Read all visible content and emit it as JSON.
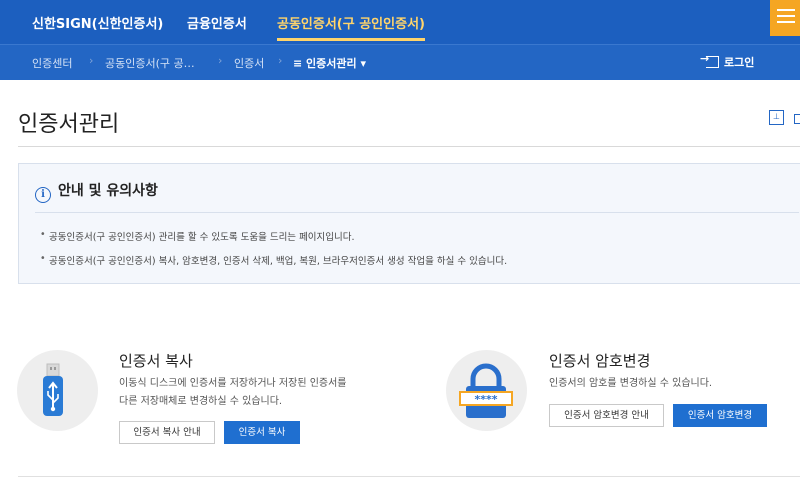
{
  "topnav": {
    "tabs": [
      {
        "label": "신한SIGN(신한인증서)"
      },
      {
        "label": "금융인증서"
      },
      {
        "label": "공동인증서(구 공인인증서)"
      }
    ]
  },
  "breadcrumb": {
    "items": [
      "인증센터",
      "공동인증서(구 공…",
      "인증서"
    ],
    "current": "≡ 인증서관리 ▾"
  },
  "login_label": "로그인",
  "page_title": "인증서관리",
  "notice": {
    "heading": "안내 및 유의사항",
    "info_glyph": "i",
    "items": [
      "공동인증서(구 공인인증서) 관리를 할 수 있도록 도움을 드리는 페이지입니다.",
      "공동인증서(구 공인인증서) 복사, 암호변경, 인증서 삭제, 백업, 복원, 브라우저인증서 생성 작업을 하실 수 있습니다."
    ]
  },
  "cards": [
    {
      "title": "인증서 복사",
      "desc": [
        "이동식 디스크에 인증서를 저장하거나 저장된 인증서를",
        "다른 저장매체로 변경하실 수 있습니다."
      ],
      "guide_label": "인증서 복사 안내",
      "action_label": "인증서 복사",
      "icon": "usb-drive-icon"
    },
    {
      "title": "인증서 암호변경",
      "desc": [
        "인증서의 암호를 변경하실 수 있습니다."
      ],
      "guide_label": "인증서 암호변경 안내",
      "action_label": "인증서 암호변경",
      "icon": "padlock-password-icon",
      "password_mask": "****"
    }
  ],
  "colors": {
    "primary": "#1c5fbf",
    "accent": "#ffd46b",
    "menu": "#f5a623",
    "button": "#1f6fd0"
  }
}
